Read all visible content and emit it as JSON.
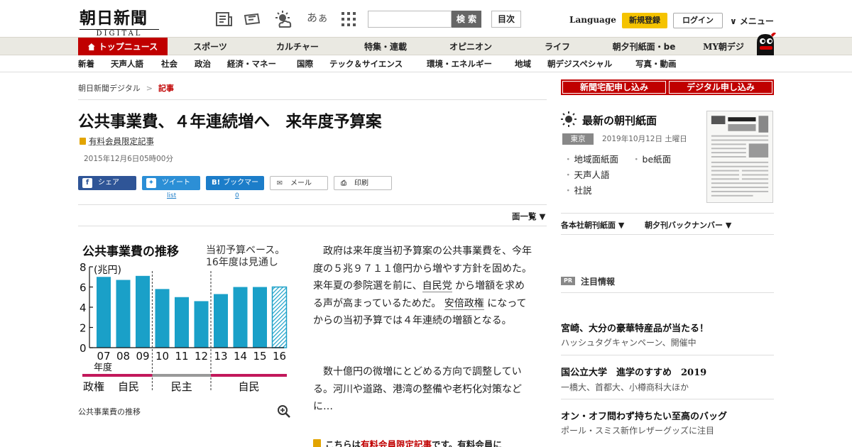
{
  "header": {
    "logo_ja": "朝日新聞",
    "logo_en": "DIGITAL",
    "font_size_icon_label": "あぁ",
    "search_button": "検 索",
    "toc_button": "目次",
    "language": "Language",
    "register": "新規登録",
    "login": "ログイン",
    "menu": "∨ メニュー"
  },
  "nav_primary": [
    {
      "label": "トップニュース",
      "active": true
    },
    {
      "label": "スポーツ"
    },
    {
      "label": "カルチャー"
    },
    {
      "label": "特集・連載"
    },
    {
      "label": "オピニオン"
    },
    {
      "label": "ライフ"
    },
    {
      "label": "朝夕刊紙面・be"
    },
    {
      "label": "MY朝デジ"
    }
  ],
  "nav_secondary": [
    "新着",
    "天声人語",
    "社会",
    "政治",
    "経済・マネー",
    "国際",
    "テック＆サイエンス",
    "環境・エネルギー",
    "地域",
    "朝デジスペシャル",
    "写真・動画"
  ],
  "breadcrumb": {
    "home": "朝日新聞デジタル",
    "sep": ">",
    "current": "記事"
  },
  "article": {
    "title": "公共事業費、４年連続増へ　来年度予算案",
    "paid_label": "有料会員限定記事",
    "date": "2015年12月6日05時00分",
    "share": {
      "facebook": "シェア",
      "twitter": "ツイート",
      "twitter_count": "list",
      "hatena": "ブックマーク",
      "hatena_icon": "B!",
      "hatena_count": "0",
      "mail": "メール",
      "print": "印刷"
    },
    "page_list": "面一覧 ▼",
    "figure_caption": "公共事業費の推移",
    "para1_pre": "政府は来年度当初予算案の公共事業費を、今年度の５兆９７１１億円から増やす方針を固めた。来年夏の参院選を前に、",
    "para1_link1": "自民党",
    "para1_mid": "から増額を求める声が高まっているためだ。",
    "para1_link2": "安倍政権",
    "para1_post": "になってからの当初予算では４年連続の増額となる。",
    "para2": "数十億円の微増にとどめる方向で調整している。河川や道路、港湾の整備や老朽化対策などに…",
    "paywall_pre": "こちらは",
    "paywall_link": "有料会員限定記事",
    "paywall_post": "です。有料会員に"
  },
  "chart_data": {
    "type": "bar",
    "title": "公共事業費の推移",
    "subtitle_line1": "当初予算ベース。",
    "subtitle_line2": "16年度は見通し",
    "ylabel": "(兆円)",
    "ylim": [
      0,
      8
    ],
    "yticks": [
      "8",
      "6",
      "4",
      "2",
      "0"
    ],
    "categories": [
      "07",
      "08",
      "09",
      "10",
      "11",
      "12",
      "13",
      "14",
      "15",
      "16"
    ],
    "xlabel": "年度",
    "values": [
      7.0,
      6.7,
      7.1,
      5.8,
      5.0,
      4.6,
      5.3,
      6.0,
      6.0,
      6.0
    ],
    "projected_last": true,
    "bar_color": "#1aa0c8",
    "regimes": [
      {
        "label": "政権"
      },
      {
        "label": "自民"
      },
      {
        "label": "民主"
      },
      {
        "label": "自民"
      }
    ]
  },
  "sidebar": {
    "delivery_button": "新聞宅配申し込み",
    "digital_button": "デジタル申し込み",
    "paper_title": "最新の朝刊紙面",
    "region": "東京",
    "paper_date": "2019年10月12日 土曜日",
    "links": [
      "地域面紙面",
      "be紙面",
      "天声人語",
      "社説"
    ],
    "select1": "各本社朝刊紙面 ▼",
    "select2": "朝夕刊バックナンバー ▼",
    "pr": "PR",
    "notice": "注目情報",
    "ads": [
      {
        "head": "宮崎、大分の豪華特産品が当たる！",
        "sub": "ハッシュタグキャンペーン、開催中"
      },
      {
        "head": "国公立大学　進学のすすめ　2019",
        "sub": "一橋大、首都大、小樽商科大ほか"
      },
      {
        "head": "オン・オフ問わず持ちたい至高のバッグ",
        "sub": "ポール・スミス新作レザーグッズに注目"
      }
    ]
  }
}
